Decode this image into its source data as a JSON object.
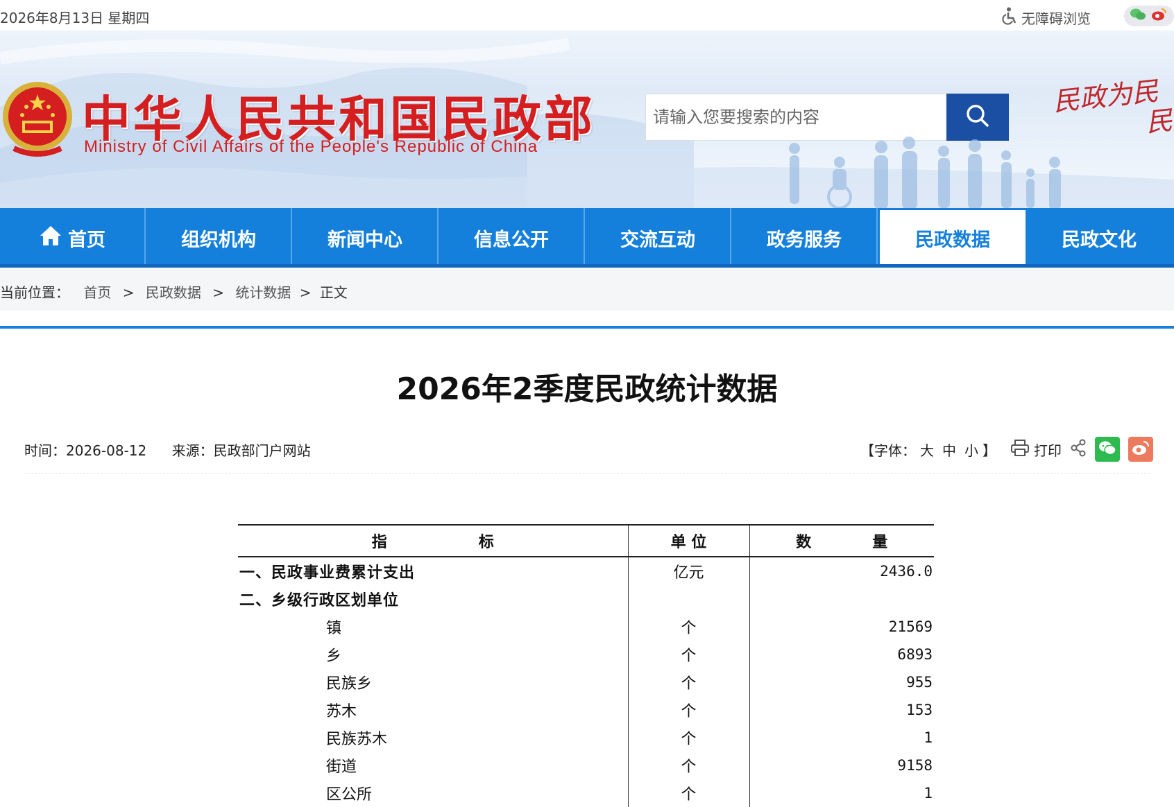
{
  "topbar": {
    "date": "2026年8月13日 星期四",
    "accessibility_label": "无障碍浏览"
  },
  "header": {
    "title_cn": "中华人民共和国民政部",
    "title_en": "Ministry of Civil Affairs of the People's Republic of China",
    "search_placeholder": "请输入您要搜索的内容",
    "slogan_line1": "民政为民",
    "slogan_line2": "民"
  },
  "nav": {
    "items": [
      {
        "label": "首页"
      },
      {
        "label": "组织机构"
      },
      {
        "label": "新闻中心"
      },
      {
        "label": "信息公开"
      },
      {
        "label": "交流互动"
      },
      {
        "label": "政务服务"
      },
      {
        "label": "民政数据"
      },
      {
        "label": "民政文化"
      }
    ],
    "active_index": 6
  },
  "breadcrumb": {
    "prefix": "当前位置：",
    "items": [
      "首页",
      "民政数据",
      "统计数据"
    ],
    "current": "正文",
    "separator": ">"
  },
  "article": {
    "title": "2026年2季度民政统计数据",
    "time_label": "时间：",
    "time": "2026-08-12",
    "source_label": "来源：",
    "source": "民政部门户网站",
    "font_size_label": "【字体：",
    "font_size_large": "大",
    "font_size_medium": "中",
    "font_size_small": "小",
    "font_size_close": "】",
    "print_label": "打印"
  },
  "table": {
    "headers": [
      "指　　　　　　标",
      "单 位",
      "数　　　　量"
    ],
    "rows": [
      {
        "name": "一、民政事业费累计支出",
        "unit": "亿元",
        "value": "2436.0"
      },
      {
        "name": "二、乡级行政区划单位",
        "unit": "",
        "value": ""
      },
      {
        "name": "镇",
        "unit": "个",
        "value": "21569"
      },
      {
        "name": "乡",
        "unit": "个",
        "value": "6893"
      },
      {
        "name": "民族乡",
        "unit": "个",
        "value": "955"
      },
      {
        "name": "苏木",
        "unit": "个",
        "value": "153"
      },
      {
        "name": "民族苏木",
        "unit": "个",
        "value": "1"
      },
      {
        "name": "街道",
        "unit": "个",
        "value": "9158"
      },
      {
        "name": "区公所",
        "unit": "个",
        "value": "1"
      }
    ]
  },
  "colors": {
    "nav_blue": "#1580dc",
    "search_button": "#1a4fa3",
    "title_red": "#d51e1f",
    "wechat_green": "#2dbb4f",
    "weibo_red": "#ee7a5d"
  }
}
